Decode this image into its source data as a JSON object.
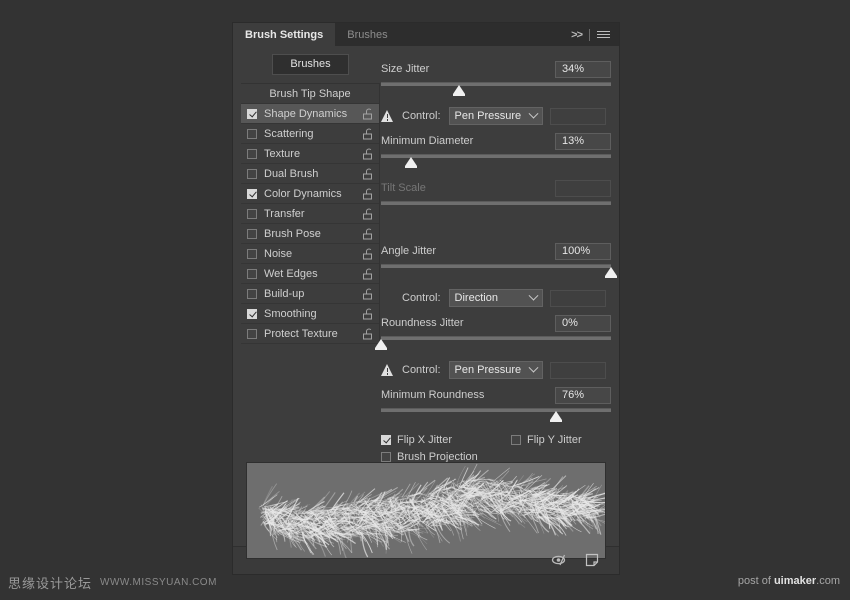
{
  "window": {
    "background_color": "#333333",
    "panel_color": "#3d3d3d"
  },
  "tabs": [
    {
      "label": "Brush Settings",
      "active": true
    },
    {
      "label": "Brushes",
      "active": false
    }
  ],
  "tabbar_right": {
    "more_icon": "chevron-double-right-icon",
    "more_glyph": ">>",
    "menu_icon": "hamburger-menu-icon"
  },
  "left": {
    "brushes_button": "Brushes",
    "header": "Brush Tip Shape",
    "items": [
      {
        "label": "Shape Dynamics",
        "checked": true,
        "selected": true,
        "locked": false
      },
      {
        "label": "Scattering",
        "checked": false,
        "selected": false,
        "locked": false
      },
      {
        "label": "Texture",
        "checked": false,
        "selected": false,
        "locked": false
      },
      {
        "label": "Dual Brush",
        "checked": false,
        "selected": false,
        "locked": false
      },
      {
        "label": "Color Dynamics",
        "checked": true,
        "selected": false,
        "locked": false
      },
      {
        "label": "Transfer",
        "checked": false,
        "selected": false,
        "locked": false
      },
      {
        "label": "Brush Pose",
        "checked": false,
        "selected": false,
        "locked": false
      },
      {
        "label": "Noise",
        "checked": false,
        "selected": false,
        "locked": false
      },
      {
        "label": "Wet Edges",
        "checked": false,
        "selected": false,
        "locked": false
      },
      {
        "label": "Build-up",
        "checked": false,
        "selected": false,
        "locked": false
      },
      {
        "label": "Smoothing",
        "checked": true,
        "selected": false,
        "locked": false
      },
      {
        "label": "Protect Texture",
        "checked": false,
        "selected": false,
        "locked": false
      }
    ],
    "lock_icon": "unlocked-padlock-icon"
  },
  "settings": {
    "size_jitter": {
      "label": "Size Jitter",
      "value": "34%",
      "slider_percent": 34,
      "control_label": "Control:",
      "control_value": "Pen Pressure",
      "warning_icon": "warning-triangle-icon",
      "has_warning": true,
      "tail_value": ""
    },
    "minimum_diameter": {
      "label": "Minimum Diameter",
      "value": "13%",
      "slider_percent": 13
    },
    "tilt_scale": {
      "label": "Tilt Scale",
      "value": "",
      "disabled": true
    },
    "angle_jitter": {
      "label": "Angle Jitter",
      "value": "100%",
      "slider_percent": 100,
      "control_label": "Control:",
      "control_value": "Direction",
      "has_warning": false,
      "tail_value": ""
    },
    "roundness_jitter": {
      "label": "Roundness Jitter",
      "value": "0%",
      "slider_percent": 0,
      "control_label": "Control:",
      "control_value": "Pen Pressure",
      "warning_icon": "warning-triangle-icon",
      "has_warning": true,
      "tail_value": ""
    },
    "minimum_roundness": {
      "label": "Minimum Roundness",
      "value": "76%",
      "slider_percent": 76
    },
    "flip_x_jitter": {
      "label": "Flip X Jitter",
      "checked": true
    },
    "flip_y_jitter": {
      "label": "Flip Y Jitter",
      "checked": false
    },
    "brush_projection": {
      "label": "Brush Projection",
      "checked": false
    }
  },
  "preview": {
    "name": "brush-stroke-preview",
    "stroke_color": "#ffffff",
    "background_color": "#6e6e6e"
  },
  "footer": {
    "icons": [
      {
        "name": "toggle-brush-settings-icon",
        "glyph": "eye-slash"
      },
      {
        "name": "new-brush-preset-icon",
        "glyph": "new-page"
      }
    ]
  },
  "watermarks": {
    "left_cn": "思缘设计论坛",
    "left_url": "WWW.MISSYUAN.COM",
    "right_prefix": "post of ",
    "right_brand": "uimaker",
    "right_suffix": ".com"
  }
}
